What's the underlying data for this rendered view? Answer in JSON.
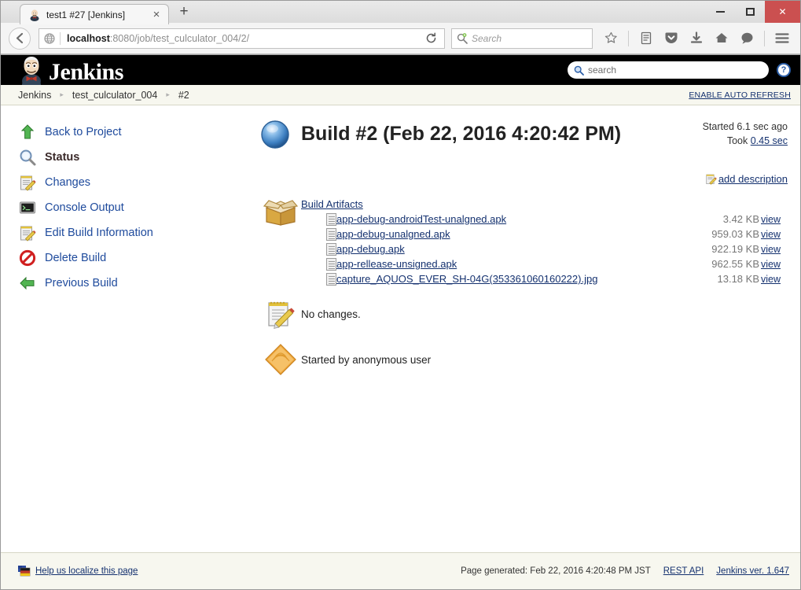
{
  "browser": {
    "tab": {
      "title": "test1 #27 [Jenkins]",
      "favicon": "jenkins-butler-icon",
      "close_label": "×",
      "new_tab_label": "+"
    },
    "window_controls": {
      "minimize": "minimize-icon",
      "maximize": "maximize-icon",
      "close": "✕"
    },
    "nav": {
      "back_label": "←",
      "reload_label": "⟳",
      "url_host": "localhost",
      "url_path": ":8080/job/test_culculator_004/2/",
      "search_placeholder": "Search",
      "icons": [
        "star-icon",
        "reading-list-icon",
        "pocket-icon",
        "download-icon",
        "home-icon",
        "chat-icon",
        "menu-icon"
      ]
    }
  },
  "jenkins": {
    "brand": "Jenkins",
    "search_placeholder": "search",
    "help_label": "?",
    "breadcrumbs": [
      {
        "label": "Jenkins"
      },
      {
        "label": "test_culculator_004"
      },
      {
        "label": "#2"
      }
    ],
    "auto_refresh_label": "ENABLE AUTO REFRESH"
  },
  "sidebar": {
    "items": [
      {
        "label": "Back to Project",
        "icon": "green-up-arrow-icon",
        "active": false
      },
      {
        "label": "Status",
        "icon": "magnifier-icon",
        "active": true
      },
      {
        "label": "Changes",
        "icon": "notepad-pencil-icon",
        "active": false
      },
      {
        "label": "Console Output",
        "icon": "terminal-icon",
        "active": false
      },
      {
        "label": "Edit Build Information",
        "icon": "notepad-pencil-icon",
        "active": false
      },
      {
        "label": "Delete Build",
        "icon": "delete-forbidden-icon",
        "active": false
      },
      {
        "label": "Previous Build",
        "icon": "green-left-arrow-icon",
        "active": false
      }
    ]
  },
  "build": {
    "status_icon": "blue-ball-success-icon",
    "title": "Build #2 (Feb 22, 2016 4:20:42 PM)",
    "started": "Started 6.1 sec ago",
    "took_prefix": "Took ",
    "took_duration": "0.45 sec",
    "add_description_label": "add description",
    "add_description_icon": "notepad-pencil-icon"
  },
  "artifacts": {
    "icon": "package-box-icon",
    "heading": "Build Artifacts",
    "view_label": "view",
    "items": [
      {
        "name": "app-debug-androidTest-unalgned.apk",
        "size": "3.42 KB"
      },
      {
        "name": "app-debug-unalgned.apk",
        "size": "959.03 KB"
      },
      {
        "name": "app-debug.apk",
        "size": "922.19 KB"
      },
      {
        "name": "app-rellease-unsigned.apk",
        "size": "962.55 KB"
      },
      {
        "name": "capture_AQUOS_EVER_SH-04G(353361060160222).jpg",
        "size": "13.18 KB"
      }
    ]
  },
  "changes": {
    "icon": "notepad-pencil-icon",
    "text": "No changes."
  },
  "cause": {
    "icon": "orange-diamond-user-icon",
    "text": "Started by anonymous user"
  },
  "footer": {
    "localize_label": "Help us localize this page",
    "localize_icon": "flags-icon",
    "page_generated": "Page generated: Feb 22, 2016 4:20:48 PM JST",
    "rest_api_label": "REST API",
    "version_label": "Jenkins ver. 1.647"
  },
  "colors": {
    "jenkins_header_bg": "#000000",
    "breadcrumb_bg": "#f7f7ef",
    "link": "#14316f",
    "status_ball": "#3b7fc4",
    "close_button": "#cb5050"
  }
}
